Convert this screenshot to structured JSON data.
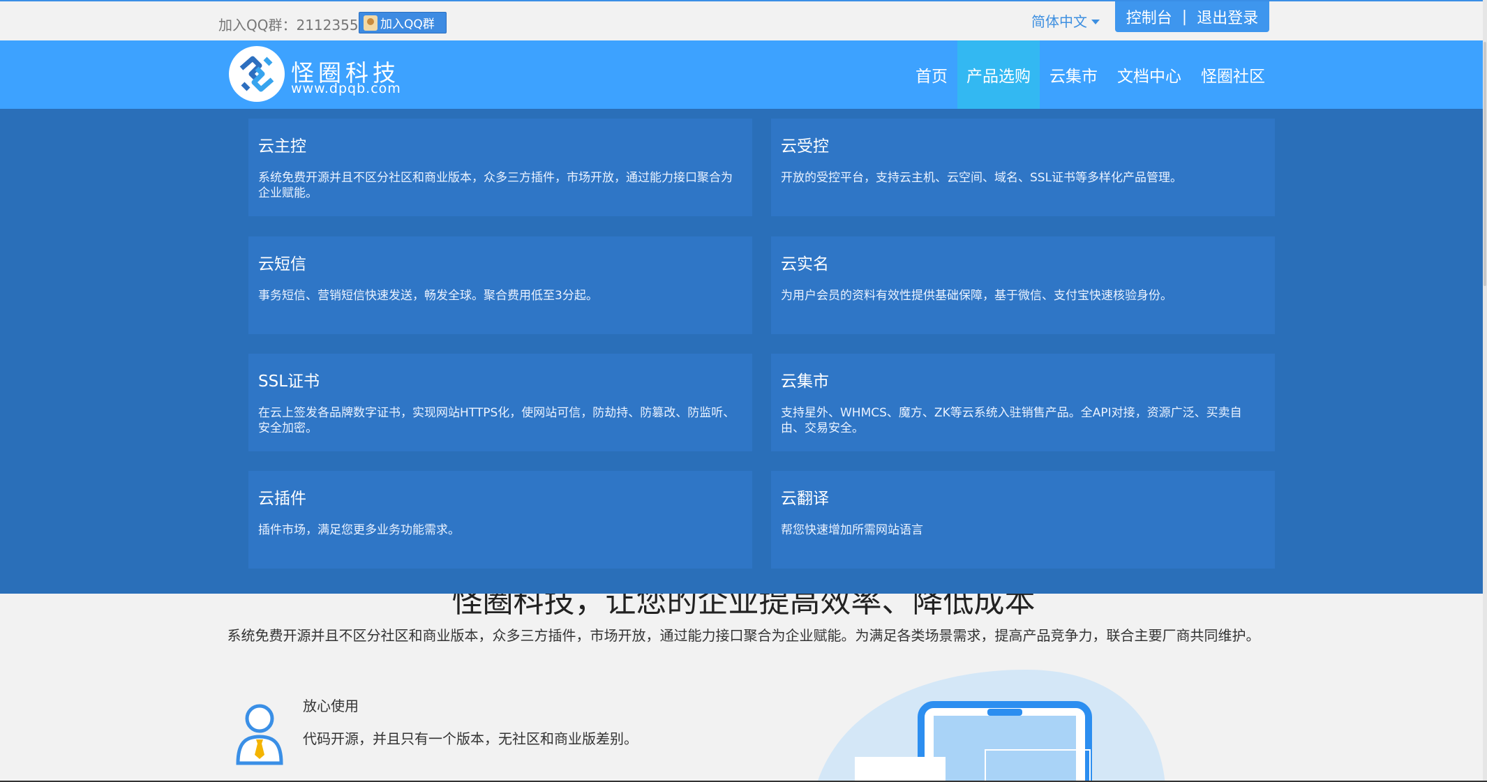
{
  "topbar": {
    "qq_group_text": "加入QQ群：2112355",
    "qq_button_label": "加入QQ群",
    "language": "简体中文",
    "console_label": "控制台",
    "separator": "|",
    "logout_label": "退出登录"
  },
  "header": {
    "brand": "怪圈科技",
    "domain": "www.dpqb.com",
    "nav": [
      {
        "label": "首页",
        "active": false
      },
      {
        "label": "产品选购",
        "active": true
      },
      {
        "label": "云集市",
        "active": false
      },
      {
        "label": "文档中心",
        "active": false
      },
      {
        "label": "怪圈社区",
        "active": false
      }
    ]
  },
  "dropdown": {
    "cards": [
      {
        "title": "云主控",
        "desc": "系统免费开源并且不区分社区和商业版本，众多三方插件，市场开放，通过能力接口聚合为企业赋能。"
      },
      {
        "title": "云受控",
        "desc": "开放的受控平台，支持云主机、云空间、域名、SSL证书等多样化产品管理。"
      },
      {
        "title": "云短信",
        "desc": "事务短信、营销短信快速发送，畅发全球。聚合费用低至3分起。"
      },
      {
        "title": "云实名",
        "desc": "为用户会员的资料有效性提供基础保障，基于微信、支付宝快速核验身份。"
      },
      {
        "title": "SSL证书",
        "desc": "在云上签发各品牌数字证书，实现网站HTTPS化，使网站可信，防劫持、防篡改、防监听、安全加密。"
      },
      {
        "title": "云集市",
        "desc": "支持星外、WHMCS、魔方、ZK等云系统入驻销售产品。全API对接，资源广泛、买卖自由、交易安全。"
      },
      {
        "title": "云插件",
        "desc": "插件市场，满足您更多业务功能需求。"
      },
      {
        "title": "云翻译",
        "desc": "帮您快速增加所需网站语言"
      }
    ]
  },
  "hero": {
    "title": "怪圈科技，让您的企业提高效率、降低成本",
    "subtitle": "系统免费开源并且不区分社区和商业版本，众多三方插件，市场开放，通过能力接口聚合为企业赋能。为满足各类场景需求，提高产品竞争力，联合主要厂商共同维护。"
  },
  "feature": {
    "title": "放心使用",
    "desc": "代码开源，并且只有一个版本，无社区和商业版差别。"
  },
  "colors": {
    "header_bg": "#3da2ff",
    "nav_active_bg": "#33b8f2",
    "dropdown_bg": "#2a6fb9",
    "card_bg": "#2f76c6",
    "console_bg": "#3e96ee"
  }
}
